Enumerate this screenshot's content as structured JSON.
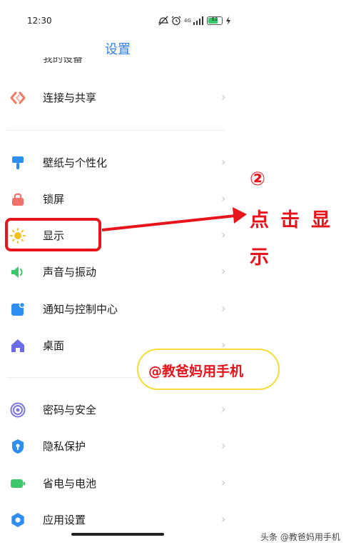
{
  "status_bar": {
    "time": "12:30",
    "network": "4G",
    "battery": "82",
    "battery_level": 0.82
  },
  "header": {
    "title": "设置"
  },
  "partial_item": "我的设备",
  "settings": [
    {
      "label": "连接与共享",
      "icon": "share-icon",
      "color": "#f07a60"
    },
    {
      "label": "壁纸与个性化",
      "icon": "paintbrush-icon",
      "color": "#2f8ef2"
    },
    {
      "label": "锁屏",
      "icon": "lock-icon",
      "color": "#f0706a"
    },
    {
      "label": "显示",
      "icon": "sun-icon",
      "color": "#f5c024"
    },
    {
      "label": "声音与振动",
      "icon": "speaker-icon",
      "color": "#3cc86a"
    },
    {
      "label": "通知与控制中心",
      "icon": "notification-icon",
      "color": "#2f8ef2"
    },
    {
      "label": "桌面",
      "icon": "home-icon",
      "color": "#6a6ce8"
    },
    {
      "label": "密码与安全",
      "icon": "fingerprint-icon",
      "color": "#7b76e0"
    },
    {
      "label": "隐私保护",
      "icon": "privacy-shield-icon",
      "color": "#2f8ef2"
    },
    {
      "label": "省电与电池",
      "icon": "battery-icon",
      "color": "#3cc86a"
    },
    {
      "label": "应用设置",
      "icon": "gear-icon",
      "color": "#2f8ef2"
    }
  ],
  "chevron": "›",
  "annotation": {
    "step": "②",
    "instruction": "点击显示",
    "watermark": "@教爸妈用手机",
    "color": "#e8141c"
  },
  "footer": "头条 @教爸妈用手机"
}
